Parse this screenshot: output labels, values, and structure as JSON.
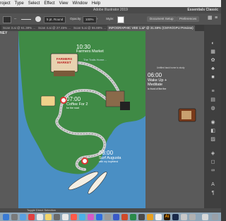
{
  "menubar": {
    "items": [
      "roject",
      "Type",
      "Select",
      "Effect",
      "View",
      "Window",
      "Help"
    ],
    "right_text": "Essentials Classic"
  },
  "window": {
    "title": "Adobe Illustrator 2019"
  },
  "controlbar": {
    "stroke_profile": "5 pt. Round",
    "opacity_label": "Opacity:",
    "opacity_value": "100%",
    "style_label": "Style:",
    "doc_setup": "Document Setup",
    "preferences": "Preferences"
  },
  "tabs": [
    {
      "label": "Scan 3.ai @ 61.38% ..."
    },
    {
      "label": "Scan 4.ai @ 27.45% ..."
    },
    {
      "label": "Scan 5.ai @ 55.88% ..."
    },
    {
      "label": "INFOGRAPHIC VEE 1.ai* @ 31.59% (CMYK/GPU Preview)"
    }
  ],
  "canvas": {
    "left_label": "NEY",
    "timeline": [
      {
        "time": "10:30",
        "desc": "Farmers Market"
      },
      {
        "time": "07:00",
        "desc": "Coffee For 2",
        "sub": "for the road"
      },
      {
        "time": "08:00",
        "desc": "Surf Augusta",
        "sub": "with my boyfriend"
      },
      {
        "time": "06:00",
        "desc": "Wake Up + Meditate",
        "sub": "in front of the fire"
      }
    ],
    "market_sign": [
      "FARMERS",
      "MARKET"
    ],
    "right_note": "Untitled back home to study",
    "handwritten": "The Trails Home..."
  },
  "status": {
    "text": "Toggle Direct Selection"
  },
  "colors": {
    "ocean": "#4a8fc4",
    "land": "#3f8a45",
    "road": "#c9c9c9",
    "canvas_bg": "#5a5a5a"
  }
}
